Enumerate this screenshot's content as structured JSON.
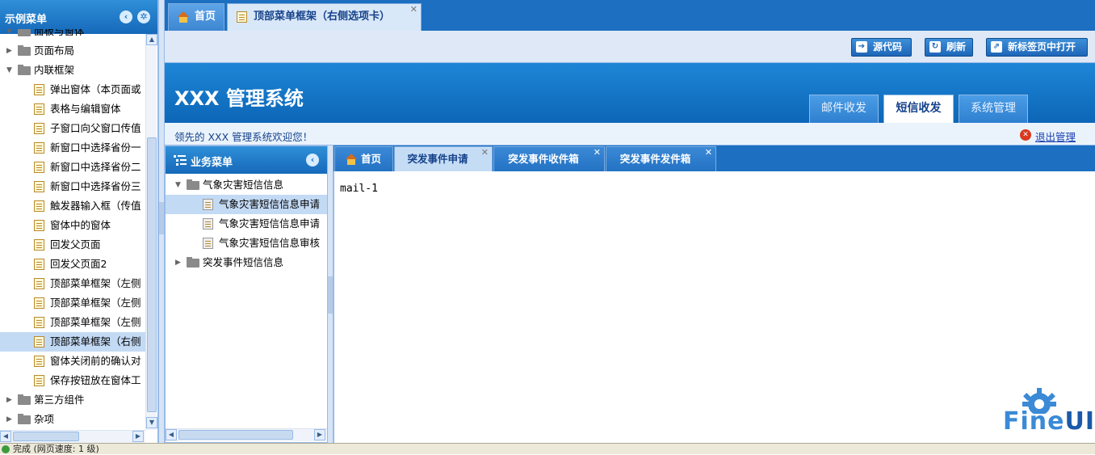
{
  "left_panel": {
    "title": "示例菜单",
    "tree": [
      {
        "label": "面板与窗体",
        "type": "folder",
        "level": 0,
        "state": "expanded"
      },
      {
        "label": "页面布局",
        "type": "folder",
        "level": 0,
        "state": "collapsed"
      },
      {
        "label": "内联框架",
        "type": "folder",
        "level": 0,
        "state": "expanded"
      },
      {
        "label": "弹出窗体（本页面或",
        "type": "page",
        "level": 1
      },
      {
        "label": "表格与编辑窗体",
        "type": "page",
        "level": 1
      },
      {
        "label": "子窗口向父窗口传值",
        "type": "page",
        "level": 1
      },
      {
        "label": "新窗口中选择省份一",
        "type": "page",
        "level": 1
      },
      {
        "label": "新窗口中选择省份二",
        "type": "page",
        "level": 1
      },
      {
        "label": "新窗口中选择省份三",
        "type": "page",
        "level": 1
      },
      {
        "label": "触发器输入框（传值",
        "type": "page",
        "level": 1
      },
      {
        "label": "窗体中的窗体",
        "type": "page",
        "level": 1
      },
      {
        "label": "回发父页面",
        "type": "page",
        "level": 1
      },
      {
        "label": "回发父页面2",
        "type": "page",
        "level": 1
      },
      {
        "label": "顶部菜单框架（左侧",
        "type": "page",
        "level": 1
      },
      {
        "label": "顶部菜单框架（左侧",
        "type": "page",
        "level": 1
      },
      {
        "label": "顶部菜单框架（左侧",
        "type": "page",
        "level": 1
      },
      {
        "label": "顶部菜单框架（右侧",
        "type": "page",
        "level": 1,
        "selected": true
      },
      {
        "label": "窗体关闭前的确认对",
        "type": "page",
        "level": 1
      },
      {
        "label": "保存按钮放在窗体工",
        "type": "page",
        "level": 1
      },
      {
        "label": "第三方组件",
        "type": "folder",
        "level": 0,
        "state": "collapsed"
      },
      {
        "label": "杂项",
        "type": "folder",
        "level": 0,
        "state": "collapsed"
      }
    ]
  },
  "top_tabs": [
    {
      "label": "首页",
      "icon": "home-icon",
      "active": false
    },
    {
      "label": "顶部菜单框架（右侧选项卡）",
      "icon": "page-icon",
      "active": true,
      "closable": true
    }
  ],
  "toolbar": {
    "source_label": "源代码",
    "refresh_label": "刷新",
    "new_tab_label": "新标签页中打开"
  },
  "header": {
    "brand": "XXX 管理系统",
    "tabs": [
      {
        "label": "邮件收发",
        "active": false
      },
      {
        "label": "短信收发",
        "active": true
      },
      {
        "label": "系统管理",
        "active": false
      }
    ]
  },
  "welcome": {
    "text": "领先的 XXX 管理系统欢迎您！",
    "logout_label": "退出管理"
  },
  "inner_menu": {
    "title": "业务菜单",
    "tree": [
      {
        "label": "气象灾害短信信息",
        "type": "folder",
        "state": "expanded",
        "level": 0
      },
      {
        "label": "气象灾害短信信息申请",
        "type": "page",
        "level": 1,
        "selected": true
      },
      {
        "label": "气象灾害短信信息申请",
        "type": "page",
        "level": 1
      },
      {
        "label": "气象灾害短信信息审核",
        "type": "page",
        "level": 1
      },
      {
        "label": "突发事件短信信息",
        "type": "folder",
        "state": "collapsed",
        "level": 0
      }
    ]
  },
  "content_tabs": [
    {
      "label": "首页",
      "icon": "home-icon",
      "active": false
    },
    {
      "label": "突发事件申请",
      "active": true,
      "closable": true
    },
    {
      "label": "突发事件收件箱",
      "active": false,
      "closable": true
    },
    {
      "label": "突发事件发件箱",
      "active": false,
      "closable": true
    }
  ],
  "content": {
    "text": "mail-1"
  },
  "logo": {
    "part1": "Fine",
    "part2": "UI"
  },
  "status_bar": {
    "text": "完成 (网页速度: 1 级)"
  },
  "colors": {
    "primary_blue": "#1c6fc1",
    "header_blue": "#1e86d6",
    "selected_bg": "#c3daf5",
    "logo_blue": "#3a8ad6"
  }
}
